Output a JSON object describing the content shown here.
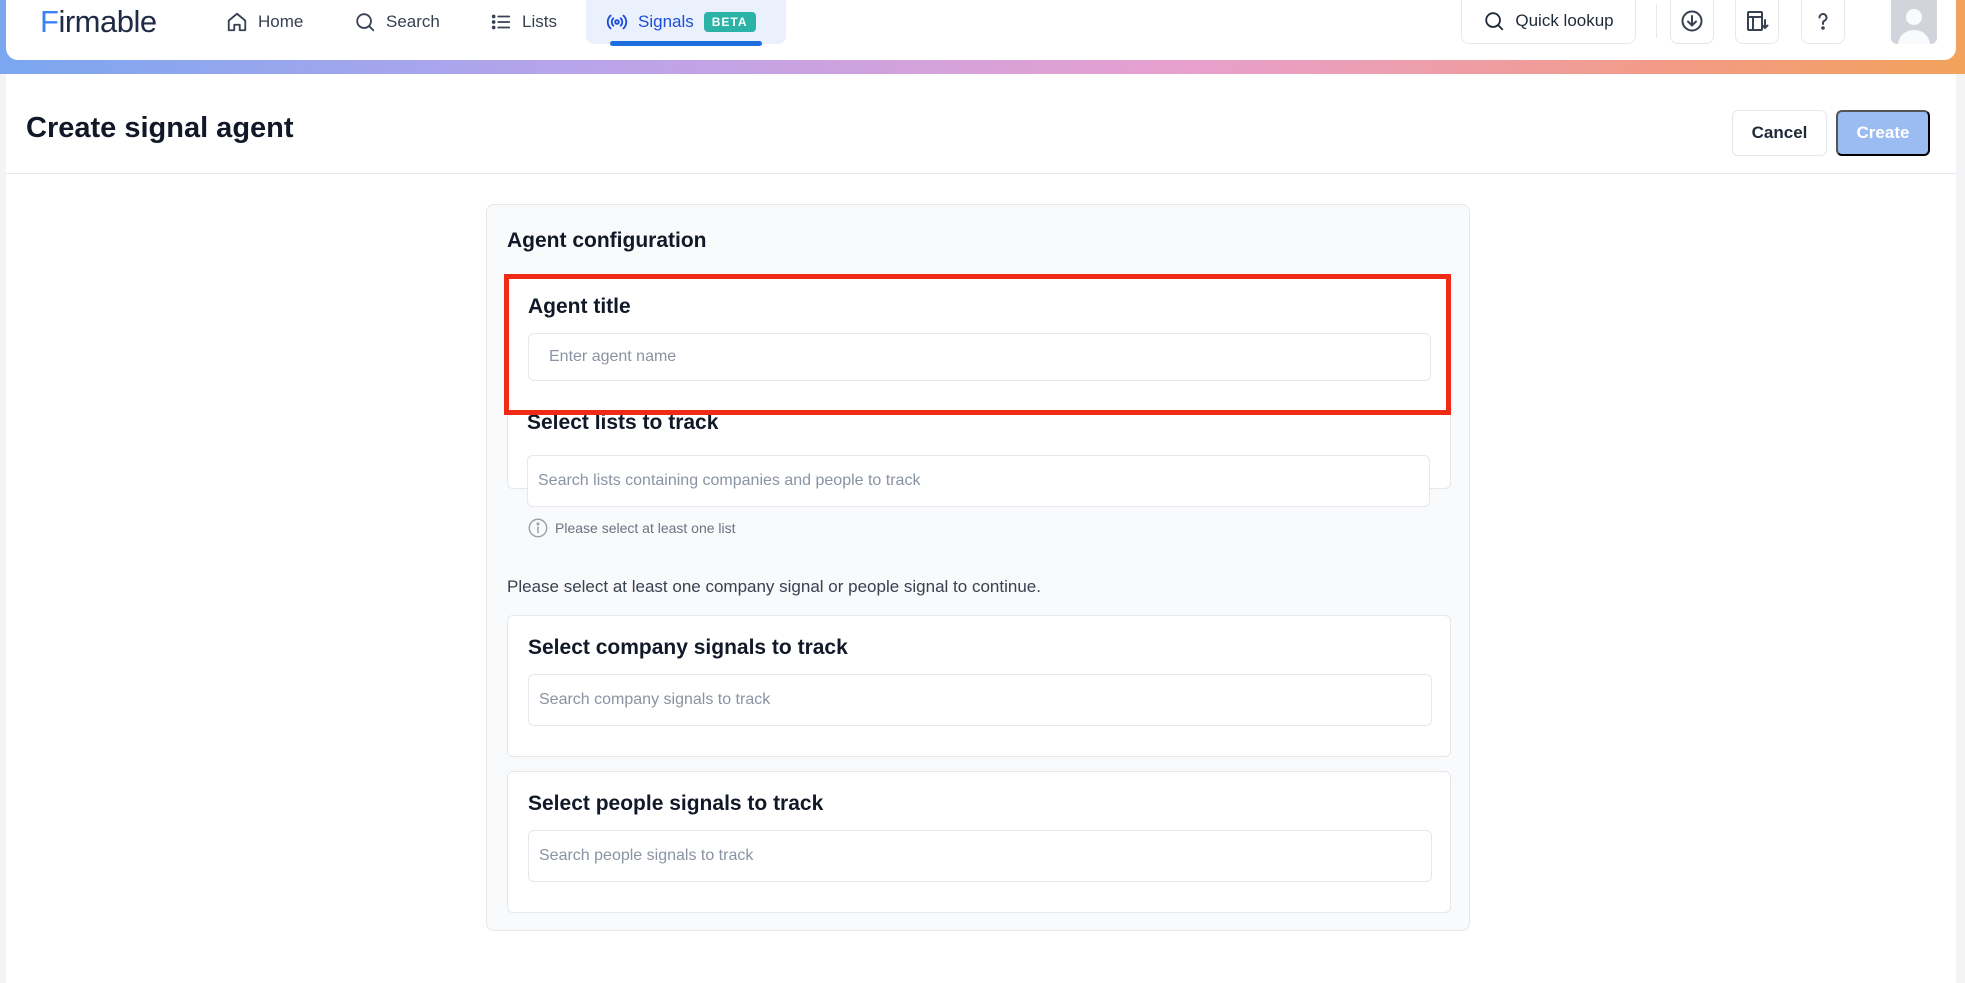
{
  "nav": {
    "logo": "Firmable",
    "items": [
      {
        "label": "Home",
        "icon": "home-icon"
      },
      {
        "label": "Search",
        "icon": "search-icon"
      },
      {
        "label": "Lists",
        "icon": "list-icon"
      },
      {
        "label": "Signals",
        "icon": "signal-icon",
        "badge": "BETA",
        "active": true
      }
    ],
    "quick_lookup": "Quick lookup",
    "icons": [
      "download-icon",
      "table-export-icon",
      "help-icon",
      "avatar"
    ]
  },
  "header": {
    "title": "Create signal agent",
    "cancel_label": "Cancel",
    "create_label": "Create"
  },
  "config": {
    "title": "Agent configuration",
    "agent_title": {
      "label": "Agent title",
      "placeholder": "Enter agent name",
      "value": ""
    },
    "lists": {
      "label": "Select lists to track",
      "placeholder": "Search lists containing companies and people to track",
      "hint": "Please select at least one list"
    },
    "signals_helper": "Please select at least one company signal or people signal to continue.",
    "company_signals": {
      "label": "Select company signals to track",
      "placeholder": "Search company signals to track"
    },
    "people_signals": {
      "label": "Select people signals to track",
      "placeholder": "Search people signals to track"
    }
  },
  "colors": {
    "accent": "#1d6fe0",
    "beta_badge": "#2ab3a6",
    "create_disabled": "#9bbcf0",
    "highlight": "#ef2a17"
  }
}
